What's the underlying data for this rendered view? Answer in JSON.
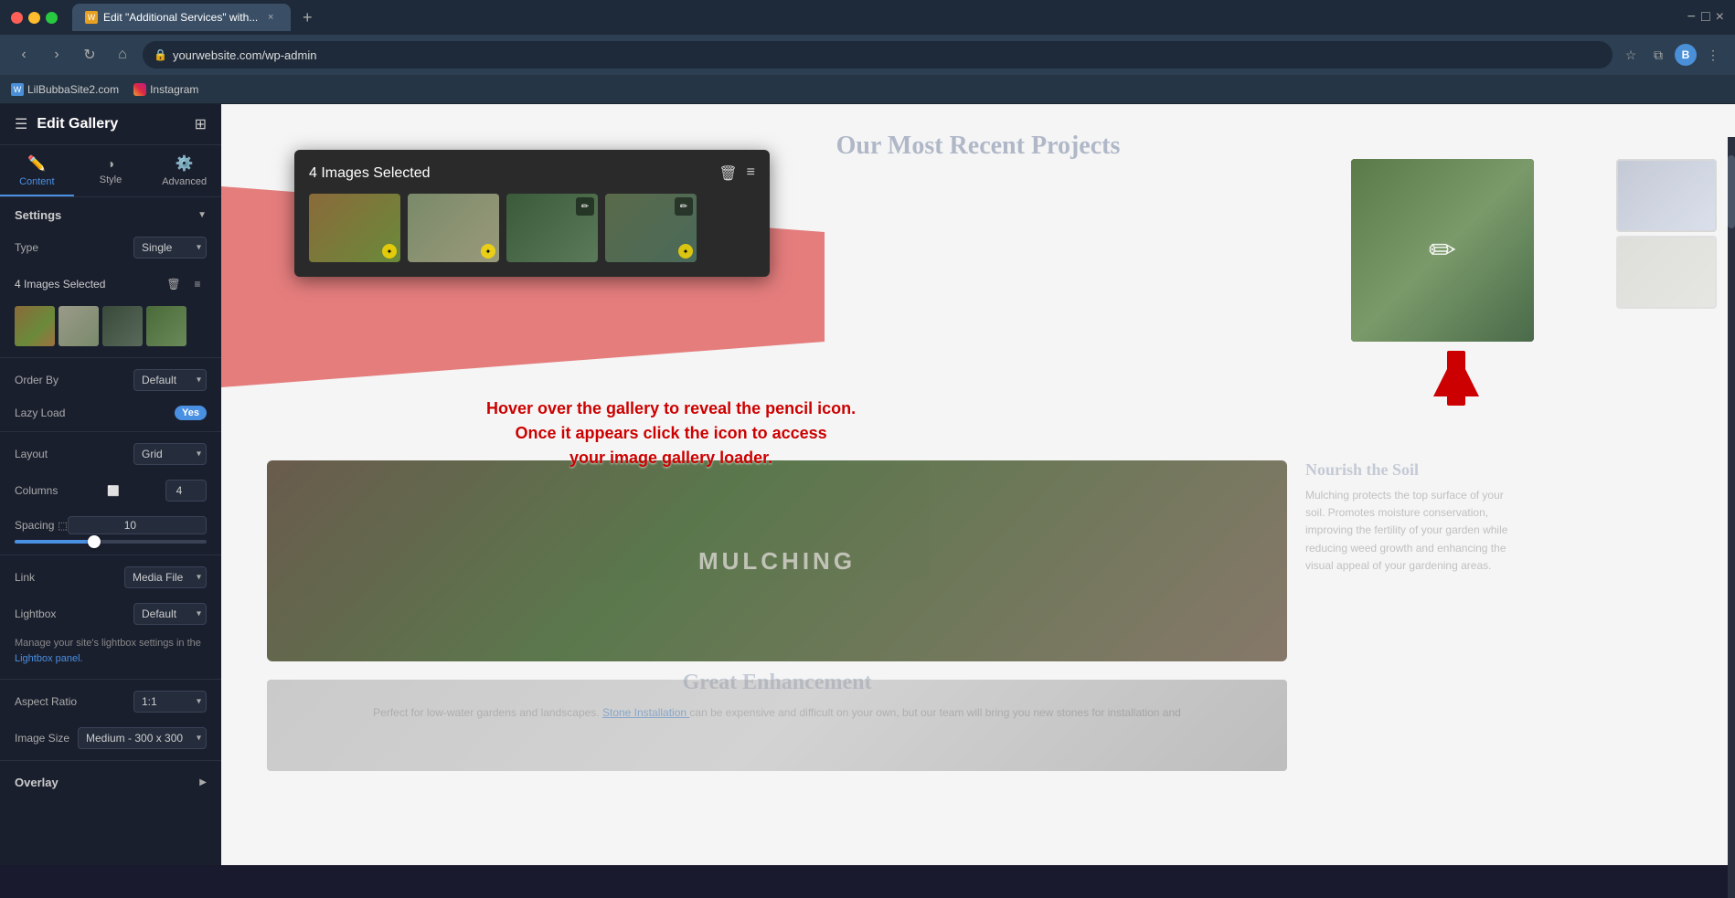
{
  "browser": {
    "tab_title": "Edit \"Additional Services\" with...",
    "address": "yourwebsite.com/wp-admin",
    "bookmarks": [
      {
        "label": "LilBubbaSite2.com",
        "color": "#4a90d9"
      },
      {
        "label": "Instagram",
        "color": "#e1306c"
      }
    ]
  },
  "sidebar": {
    "title": "Edit Gallery",
    "tabs": [
      {
        "label": "Content",
        "icon": "✏️",
        "active": true
      },
      {
        "label": "Style",
        "icon": "◑"
      },
      {
        "label": "Advanced",
        "icon": "⚙️"
      }
    ],
    "sections": {
      "settings": {
        "title": "Settings",
        "collapsed": false
      }
    },
    "fields": {
      "type_label": "Type",
      "type_value": "Single",
      "images_selected": "4 Images Selected",
      "order_by_label": "Order By",
      "order_by_value": "Default",
      "lazy_load_label": "Lazy Load",
      "lazy_load_value": "Yes",
      "layout_label": "Layout",
      "layout_value": "Grid",
      "columns_label": "Columns",
      "columns_value": "4",
      "spacing_label": "Spacing",
      "spacing_value": "10",
      "link_label": "Link",
      "link_value": "Media File",
      "lightbox_label": "Lightbox",
      "lightbox_value": "Default",
      "lightbox_note": "Manage your site's lightbox settings in the",
      "lightbox_link_text": "Lightbox panel.",
      "aspect_ratio_label": "Aspect Ratio",
      "aspect_ratio_value": "1:1",
      "image_size_label": "Image Size",
      "image_size_value": "Medium - 300 x 300",
      "overlay_label": "Overlay"
    }
  },
  "main": {
    "section_title": "Our Most Recent Projects",
    "gallery_popup": {
      "title": "4 Images Selected",
      "thumbs": [
        "garden1",
        "garden2",
        "pathway",
        "garden3"
      ]
    },
    "annotation": {
      "line1": "Hover over the gallery to reveal the pencil icon.",
      "line2": "Once it appears click the icon to access",
      "line3": "your image gallery loader."
    },
    "mulching": {
      "label": "MULCHING",
      "text_title": "Nourish the Soil",
      "description": "Mulching protects the top surface of your soil. Promotes moisture conservation, improving the fertility of your garden while reducing weed growth and enhancing the visual appeal of your gardening areas."
    },
    "great_enhancement": {
      "title": "Great Enhancement",
      "text": "Perfect for low-water gardens and landscapes.",
      "link_text": "Stone Installation",
      "text2": "can be expensive and difficult on your own, but our team will bring you new stones for installation and"
    }
  }
}
